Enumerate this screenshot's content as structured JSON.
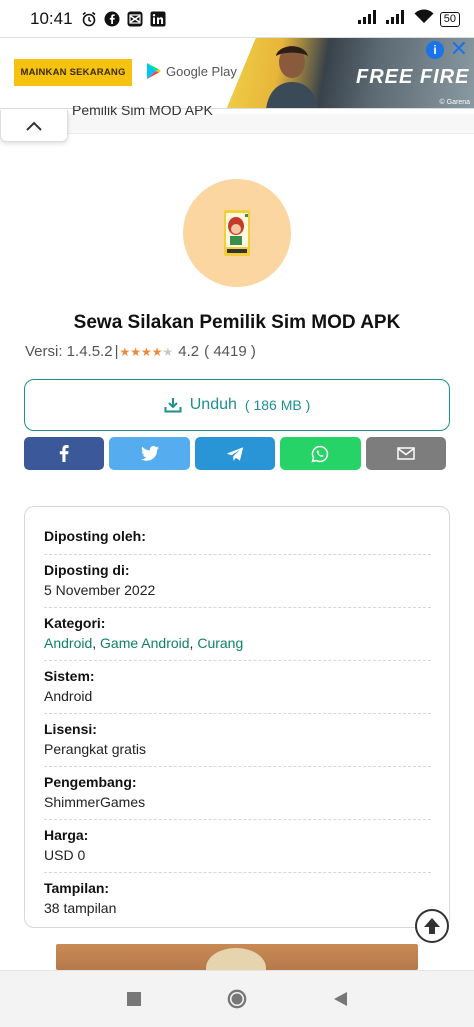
{
  "status_bar": {
    "time": "10:41",
    "battery": "50",
    "left_icons": [
      "alarm-icon",
      "facebook-icon",
      "capcut-icon",
      "linkedin-icon"
    ],
    "right_icons": [
      "signal-icon",
      "signal-icon",
      "wifi-icon",
      "battery-icon"
    ]
  },
  "ad": {
    "cta_label": "MAINKAN SEKARANG",
    "store_label": "Google Play",
    "game_logo": "FREE FIRE",
    "publisher": "© Garena",
    "info_label": "i",
    "close_label": "✕"
  },
  "header": {
    "sticky_title": "Pemilik Sim MOD APK",
    "collapse_icon": "chevron-up-icon"
  },
  "app": {
    "title": "Sewa Silakan Pemilik Sim MOD APK",
    "version_label": "Versi: 1.4.5.2",
    "separator": "|",
    "rating": 4.2,
    "rating_text": "4.2",
    "rating_count": "( 4419 )",
    "stars_max": 5,
    "star_color": "#f0883a",
    "star_empty_color": "#c8c8c8"
  },
  "download": {
    "label": "Unduh",
    "size": "( 186 MB )",
    "color": "#1f8f8f"
  },
  "share": [
    {
      "name": "facebook",
      "icon": "facebook-icon",
      "color": "#3b5998"
    },
    {
      "name": "twitter",
      "icon": "twitter-icon",
      "color": "#55acee"
    },
    {
      "name": "telegram",
      "icon": "telegram-icon",
      "color": "#2a95d6"
    },
    {
      "name": "whatsapp",
      "icon": "whatsapp-icon",
      "color": "#25d366"
    },
    {
      "name": "email",
      "icon": "email-icon",
      "color": "#7d7d7d"
    }
  ],
  "details": {
    "posted_by_label": "Diposting oleh:",
    "posted_on_label": "Diposting di:",
    "posted_on_value": "5 November 2022",
    "category_label": "Kategori:",
    "categories": [
      "Android",
      "Game Android",
      "Curang"
    ],
    "category_sep": ",",
    "system_label": "Sistem:",
    "system_value": "Android",
    "license_label": "Lisensi:",
    "license_value": "Perangkat gratis",
    "developer_label": "Pengembang:",
    "developer_value": "ShimmerGames",
    "price_label": "Harga:",
    "price_value": "USD 0",
    "views_label": "Tampilan:",
    "views_value": "38 tampilan",
    "link_color": "#10806a"
  },
  "navbar": {
    "buttons": [
      "recents-icon",
      "home-icon",
      "back-icon"
    ]
  }
}
